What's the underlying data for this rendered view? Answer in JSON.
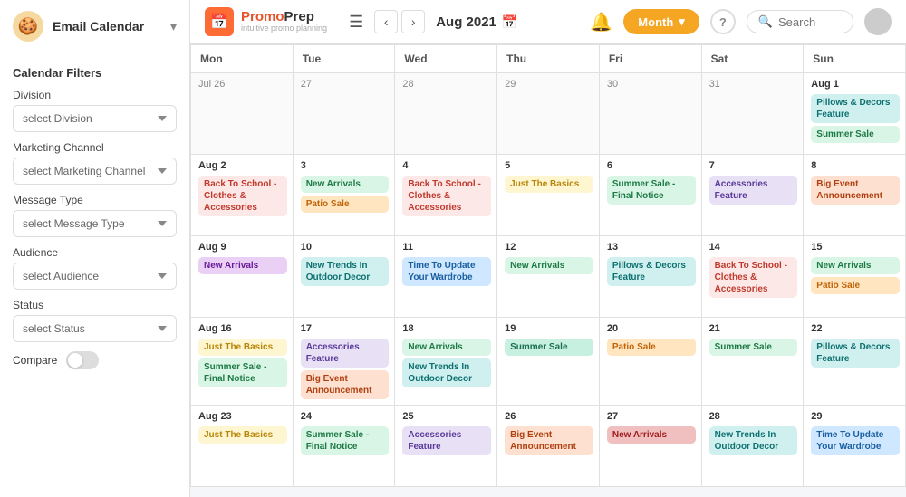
{
  "logo": {
    "icon": "📅",
    "main1": "Promo",
    "main2": "Prep",
    "sub": "intuitive promo planning"
  },
  "nav": {
    "month": "Aug 2021",
    "month_btn": "Month",
    "search_placeholder": "Search",
    "search_label": "Search"
  },
  "sidebar": {
    "title": "Email Calendar",
    "filters_title": "Calendar Filters",
    "division_label": "Division",
    "division_placeholder": "select Division",
    "marketing_label": "Marketing Channel",
    "marketing_placeholder": "select Marketing Channel",
    "message_label": "Message Type",
    "message_placeholder": "select Message Type",
    "audience_label": "Audience",
    "audience_placeholder": "select Audience",
    "status_label": "Status",
    "status_placeholder": "select Status",
    "compare_label": "Compare"
  },
  "day_headers": [
    "Mon",
    "Tue",
    "Wed",
    "Thu",
    "Fri",
    "Sat",
    "Sun"
  ],
  "weeks": [
    {
      "days": [
        {
          "date": "Jul 26",
          "month": "jul",
          "events": []
        },
        {
          "date": "27",
          "month": "jul",
          "events": []
        },
        {
          "date": "28",
          "month": "jul",
          "events": []
        },
        {
          "date": "29",
          "month": "jul",
          "events": []
        },
        {
          "date": "30",
          "month": "jul",
          "events": []
        },
        {
          "date": "31",
          "month": "jul",
          "events": []
        },
        {
          "date": "Aug 1",
          "month": "aug",
          "events": [
            {
              "label": "Pillows & Decors Feature",
              "color": "pill-teal"
            },
            {
              "label": "Summer Sale",
              "color": "pill-green"
            }
          ]
        }
      ]
    },
    {
      "days": [
        {
          "date": "Aug 2",
          "month": "aug",
          "events": [
            {
              "label": "Back To School - Clothes & Accessories",
              "color": "pill-pink"
            }
          ]
        },
        {
          "date": "3",
          "month": "aug",
          "events": [
            {
              "label": "New Arrivals",
              "color": "pill-green"
            },
            {
              "label": "Patio Sale",
              "color": "pill-orange"
            }
          ]
        },
        {
          "date": "4",
          "month": "aug",
          "events": [
            {
              "label": "Back To School - Clothes & Accessories",
              "color": "pill-pink"
            }
          ]
        },
        {
          "date": "5",
          "month": "aug",
          "events": [
            {
              "label": "Just The Basics",
              "color": "pill-yellow"
            }
          ]
        },
        {
          "date": "6",
          "month": "aug",
          "events": [
            {
              "label": "Summer Sale - Final Notice",
              "color": "pill-green"
            }
          ]
        },
        {
          "date": "7",
          "month": "aug",
          "events": [
            {
              "label": "Accessories Feature",
              "color": "pill-lavender"
            }
          ]
        },
        {
          "date": "8",
          "month": "aug",
          "events": [
            {
              "label": "Big Event Announcement",
              "color": "pill-peach"
            }
          ]
        }
      ]
    },
    {
      "days": [
        {
          "date": "Aug 9",
          "month": "aug",
          "events": [
            {
              "label": "New Arrivals",
              "color": "pill-purple"
            }
          ]
        },
        {
          "date": "10",
          "month": "aug",
          "events": [
            {
              "label": "New Trends In Outdoor Decor",
              "color": "pill-teal"
            }
          ]
        },
        {
          "date": "11",
          "month": "aug",
          "events": [
            {
              "label": "Time To Update Your Wardrobe",
              "color": "pill-blue"
            }
          ]
        },
        {
          "date": "12",
          "month": "aug",
          "events": [
            {
              "label": "New Arrivals",
              "color": "pill-green"
            }
          ]
        },
        {
          "date": "13",
          "month": "aug",
          "events": [
            {
              "label": "Pillows & Decors Feature",
              "color": "pill-teal"
            }
          ]
        },
        {
          "date": "14",
          "month": "aug",
          "events": [
            {
              "label": "Back To School - Clothes & Accessories",
              "color": "pill-pink"
            }
          ]
        },
        {
          "date": "15",
          "month": "aug",
          "events": [
            {
              "label": "New Arrivals",
              "color": "pill-green"
            },
            {
              "label": "Patio Sale",
              "color": "pill-orange"
            }
          ]
        }
      ]
    },
    {
      "days": [
        {
          "date": "Aug 16",
          "month": "aug",
          "events": [
            {
              "label": "Just The Basics",
              "color": "pill-yellow"
            },
            {
              "label": "Summer Sale - Final Notice",
              "color": "pill-green"
            }
          ]
        },
        {
          "date": "17",
          "month": "aug",
          "events": [
            {
              "label": "Accessories Feature",
              "color": "pill-lavender"
            },
            {
              "label": "Big Event Announcement",
              "color": "pill-peach"
            }
          ]
        },
        {
          "date": "18",
          "month": "aug",
          "events": [
            {
              "label": "New Arrivals",
              "color": "pill-green"
            },
            {
              "label": "New Trends In Outdoor Decor",
              "color": "pill-teal"
            }
          ]
        },
        {
          "date": "19",
          "month": "aug",
          "events": [
            {
              "label": "Summer Sale",
              "color": "pill-mint"
            }
          ]
        },
        {
          "date": "20",
          "month": "aug",
          "events": [
            {
              "label": "Patio Sale",
              "color": "pill-orange"
            }
          ]
        },
        {
          "date": "21",
          "month": "aug",
          "events": [
            {
              "label": "Summer Sale",
              "color": "pill-green"
            }
          ]
        },
        {
          "date": "22",
          "month": "aug",
          "events": [
            {
              "label": "Pillows & Decors Feature",
              "color": "pill-teal"
            }
          ]
        }
      ]
    },
    {
      "days": [
        {
          "date": "Aug 23",
          "month": "aug",
          "events": [
            {
              "label": "Just The Basics",
              "color": "pill-yellow"
            }
          ]
        },
        {
          "date": "24",
          "month": "aug",
          "events": [
            {
              "label": "Summer Sale - Final Notice",
              "color": "pill-green"
            }
          ]
        },
        {
          "date": "25",
          "month": "aug",
          "events": [
            {
              "label": "Accessories Feature",
              "color": "pill-lavender"
            }
          ]
        },
        {
          "date": "26",
          "month": "aug",
          "events": [
            {
              "label": "Big Event Announcement",
              "color": "pill-peach"
            }
          ]
        },
        {
          "date": "27",
          "month": "aug",
          "events": [
            {
              "label": "New Arrivals",
              "color": "pill-red"
            }
          ]
        },
        {
          "date": "28",
          "month": "aug",
          "events": [
            {
              "label": "New Trends In Outdoor Decor",
              "color": "pill-teal"
            }
          ]
        },
        {
          "date": "29",
          "month": "aug",
          "events": [
            {
              "label": "Time To Update Your Wardrobe",
              "color": "pill-blue"
            }
          ]
        }
      ]
    }
  ]
}
